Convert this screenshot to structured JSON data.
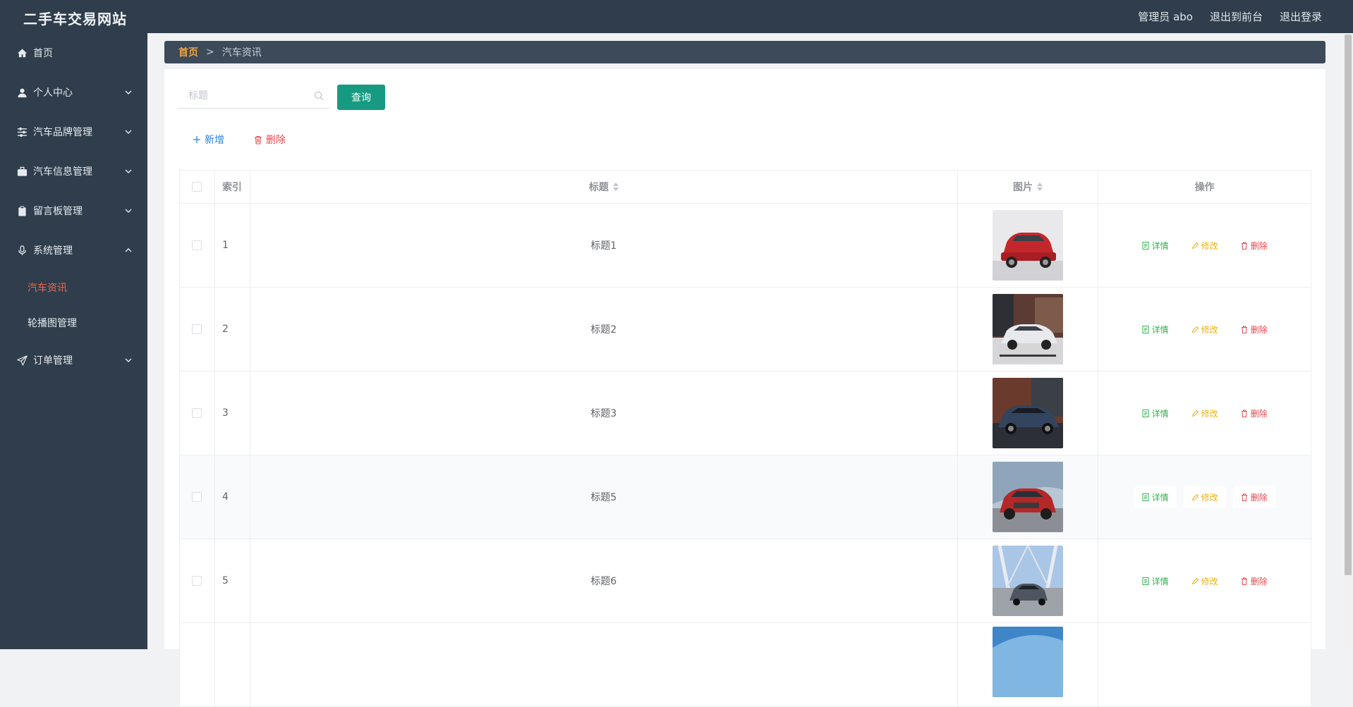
{
  "header": {
    "app_title": "二手车交易网站",
    "user_label": "管理员 abo",
    "to_front_label": "退出到前台",
    "logout_label": "退出登录"
  },
  "sidebar": {
    "items": [
      {
        "label": "首页",
        "icon": "home-icon"
      },
      {
        "label": "个人中心",
        "icon": "user-icon"
      },
      {
        "label": "汽车品牌管理",
        "icon": "sliders-icon"
      },
      {
        "label": "汽车信息管理",
        "icon": "briefcase-icon"
      },
      {
        "label": "留言板管理",
        "icon": "clipboard-icon"
      },
      {
        "label": "系统管理",
        "icon": "microphone-icon"
      },
      {
        "label": "订单管理",
        "icon": "send-icon"
      }
    ],
    "sub_items": [
      {
        "label": "汽车资讯",
        "active": true
      },
      {
        "label": "轮播图管理",
        "active": false
      }
    ]
  },
  "breadcrumb": {
    "home": "首页",
    "separator": ">",
    "current": "汽车资讯"
  },
  "search": {
    "placeholder": "标题",
    "value": "",
    "button_label": "查询"
  },
  "actions": {
    "add_label": "新增",
    "delete_label": "删除"
  },
  "table": {
    "columns": [
      "索引",
      "标题",
      "图片",
      "操作"
    ],
    "rows": [
      {
        "index": "1",
        "title": "标题1"
      },
      {
        "index": "2",
        "title": "标题2"
      },
      {
        "index": "3",
        "title": "标题3"
      },
      {
        "index": "4",
        "title": "标题5"
      },
      {
        "index": "5",
        "title": "标题6"
      }
    ],
    "ops": {
      "detail": "详情",
      "edit": "修改",
      "remove": "删除"
    }
  },
  "colors": {
    "topbar": "#2f3d4c",
    "primary_button": "#169b82",
    "active_submenu": "#f0664d",
    "breadcrumb_home": "#f0a442",
    "detail": "#2fb24f",
    "edit": "#f1b10b",
    "delete": "#e8474b",
    "add": "#2a84d8"
  }
}
